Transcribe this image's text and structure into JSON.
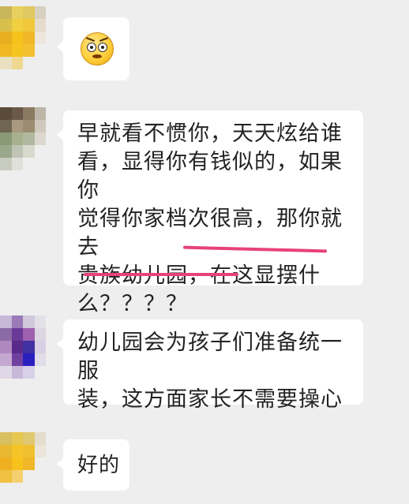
{
  "messages": [
    {
      "type": "emoji",
      "icon": "shocked-face-emoji-icon"
    },
    {
      "type": "text",
      "text": "早就看不惯你，天天炫给谁\n看，显得你有钱似的，如果你\n觉得你家档次很高，那你就去\n贵族幼儿园，在这显摆什\n么？？？？"
    },
    {
      "type": "text",
      "text": "幼儿园会为孩子们准备统一服\n装，这方面家长不需要操心"
    },
    {
      "type": "text",
      "text": "好的"
    }
  ],
  "highlight_color": "#e8417b"
}
